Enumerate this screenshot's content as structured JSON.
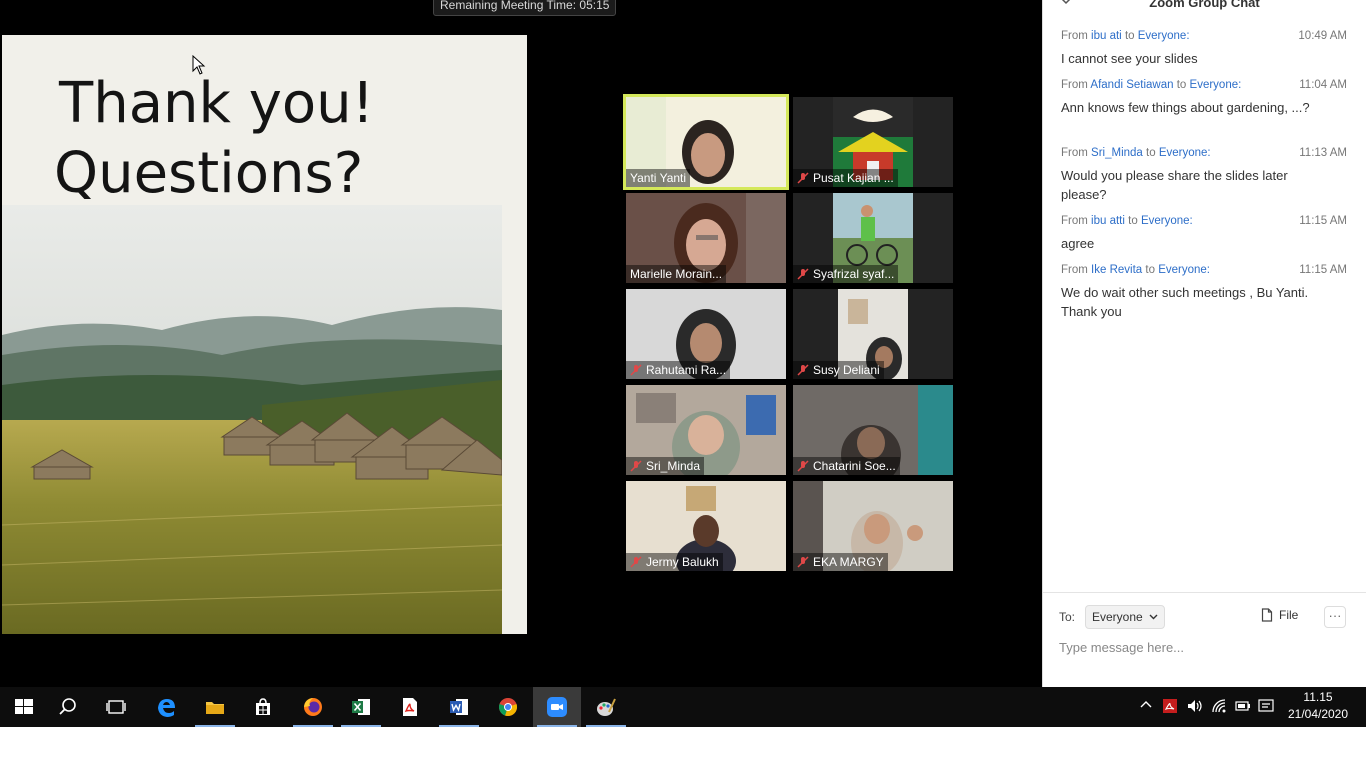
{
  "meeting": {
    "timer": "Remaining Meeting Time: 05:15"
  },
  "slide": {
    "title_line1": "Thank you!",
    "title_line2": "Questions?"
  },
  "participants": [
    {
      "name": "Yanti Yanti",
      "muted": false,
      "active": true
    },
    {
      "name": "Pusat Kajian ...",
      "muted": true,
      "active": false
    },
    {
      "name": "Marielle Morain...",
      "muted": false,
      "active": false
    },
    {
      "name": "Syafrizal syaf...",
      "muted": true,
      "active": false
    },
    {
      "name": "Rahutami Ra...",
      "muted": true,
      "active": false
    },
    {
      "name": "Susy Deliani",
      "muted": true,
      "active": false
    },
    {
      "name": "Sri_Minda",
      "muted": true,
      "active": false
    },
    {
      "name": "Chatarini Soe...",
      "muted": true,
      "active": false
    },
    {
      "name": "Jermy Balukh",
      "muted": true,
      "active": false
    },
    {
      "name": "EKA MARGY",
      "muted": true,
      "active": false
    }
  ],
  "chat": {
    "title": "Zoom Group Chat",
    "from_word": "From",
    "to_word": "to",
    "messages": [
      {
        "from": "ibu ati",
        "to": "Everyone:",
        "time": "10:49 AM",
        "text": "I cannot see your slides"
      },
      {
        "from": "Afandi Setiawan",
        "to": "Everyone:",
        "time": "11:04 AM",
        "text": "Ann knows few things about gardening, ...?"
      },
      {
        "from": "Sri_Minda",
        "to": "Everyone:",
        "time": "11:13 AM",
        "text": "Would you please share the slides later please?"
      },
      {
        "from": "ibu atti",
        "to": "Everyone:",
        "time": "11:15 AM",
        "text": "agree"
      },
      {
        "from": "Ike Revita",
        "to": "Everyone:",
        "time": "11:15 AM",
        "text": "We do wait other such meetings , Bu Yanti. Thank you"
      }
    ],
    "to_label": "To:",
    "recipient": "Everyone",
    "file_label": "File",
    "more_label": "···",
    "input_placeholder": "Type message here..."
  },
  "taskbar": {
    "time": "11.15",
    "date": "21/04/2020",
    "apps": [
      "start-icon",
      "search-icon",
      "task-view-icon",
      "edge-icon",
      "file-explorer-icon",
      "store-icon",
      "firefox-icon",
      "excel-icon",
      "acrobat-icon",
      "word-icon",
      "chrome-icon",
      "zoom-icon",
      "paint-icon"
    ]
  },
  "colors": {
    "active_speaker": "#d4e85a",
    "link_blue": "#2d6ec8",
    "taskbar": "#0d0d0d"
  }
}
